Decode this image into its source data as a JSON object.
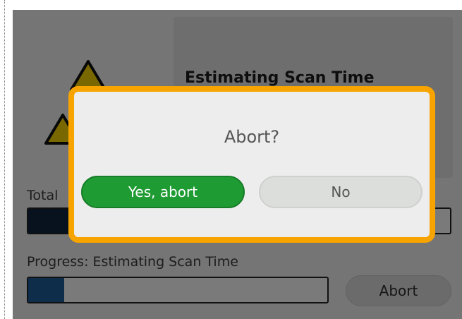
{
  "status": {
    "title": "Estimating Scan Time"
  },
  "total": {
    "label": "Total",
    "progress": 0.1
  },
  "scan": {
    "label": "Progress: Estimating Scan Time",
    "progress": 0.12
  },
  "actions": {
    "abort_label": "Abort"
  },
  "dialog": {
    "title": "Abort?",
    "confirm_label": "Yes, abort",
    "cancel_label": "No"
  },
  "colors": {
    "dialog_border": "#f7a400",
    "confirm": "#1f9b34",
    "progress_fill": "#1d5a96",
    "warning": "#f2d100"
  },
  "icons": [
    "warning-triangle-icon",
    "warning-triangle-icon"
  ]
}
